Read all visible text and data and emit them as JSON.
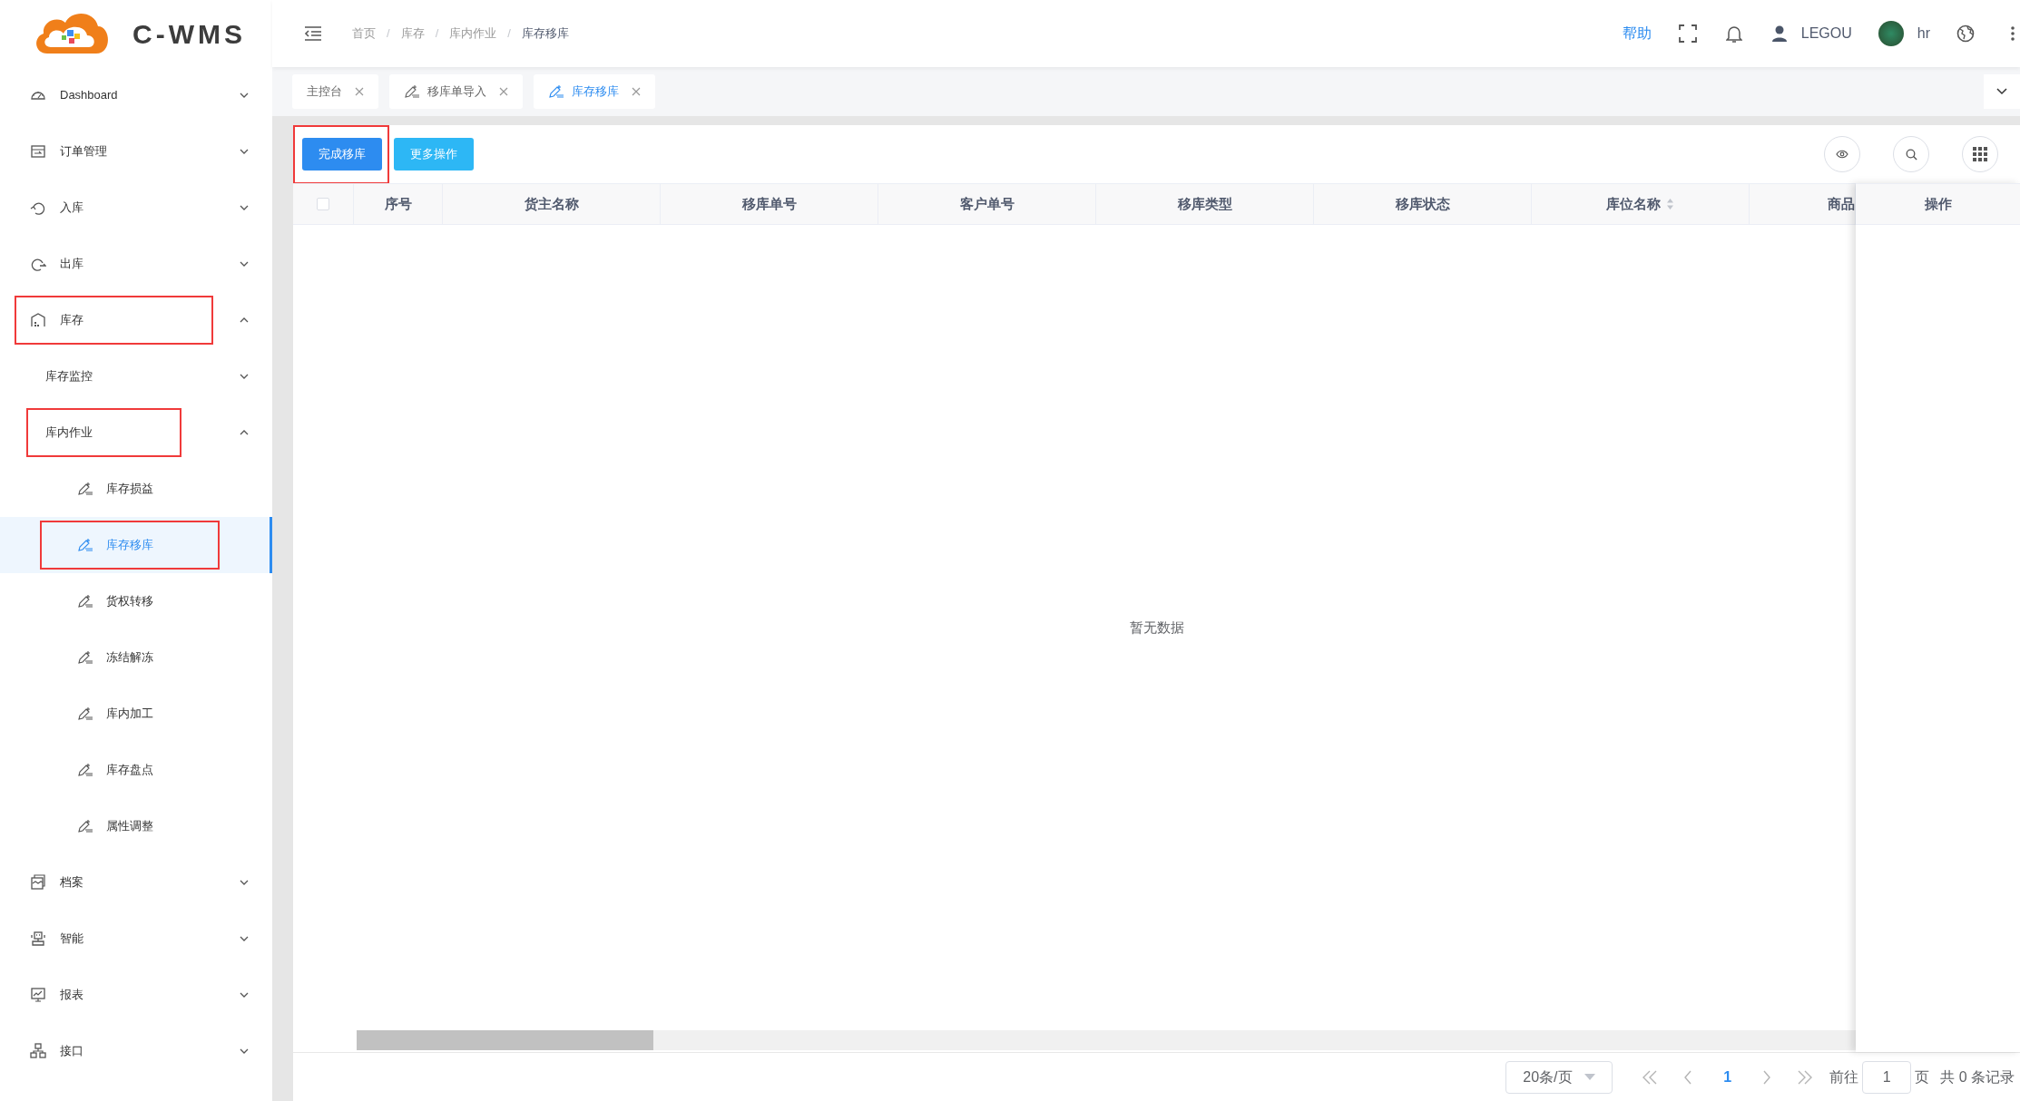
{
  "logo": {
    "text": "C-WMS"
  },
  "breadcrumb": {
    "items": [
      "首页",
      "库存",
      "库内作业",
      "库存移库"
    ],
    "separators": [
      "/",
      "/",
      "/"
    ]
  },
  "header": {
    "help": "帮助",
    "user": "LEGOU",
    "account": "hr"
  },
  "sidebar": {
    "items": [
      {
        "label": "Dashboard",
        "expanded": false,
        "annotated": false
      },
      {
        "label": "订单管理",
        "expanded": false,
        "annotated": false
      },
      {
        "label": "入库",
        "expanded": false,
        "annotated": false
      },
      {
        "label": "出库",
        "expanded": false,
        "annotated": false
      },
      {
        "label": "库存",
        "expanded": true,
        "annotated": true,
        "children": [
          {
            "label": "库存监控",
            "expanded": false,
            "annotated": false
          },
          {
            "label": "库内作业",
            "expanded": true,
            "annotated": true,
            "children": [
              {
                "label": "库存损益",
                "selected": false,
                "annotated": false
              },
              {
                "label": "库存移库",
                "selected": true,
                "annotated": true
              },
              {
                "label": "货权转移",
                "selected": false,
                "annotated": false
              },
              {
                "label": "冻结解冻",
                "selected": false,
                "annotated": false
              },
              {
                "label": "库内加工",
                "selected": false,
                "annotated": false
              },
              {
                "label": "库存盘点",
                "selected": false,
                "annotated": false
              },
              {
                "label": "属性调整",
                "selected": false,
                "annotated": false
              }
            ]
          }
        ]
      },
      {
        "label": "档案",
        "expanded": false,
        "annotated": false
      },
      {
        "label": "智能",
        "expanded": false,
        "annotated": false
      },
      {
        "label": "报表",
        "expanded": false,
        "annotated": false
      },
      {
        "label": "接口",
        "expanded": false,
        "annotated": false
      }
    ]
  },
  "tabs": [
    {
      "label": "主控台",
      "kind": "home",
      "selected": false
    },
    {
      "label": "移库单导入",
      "kind": "page",
      "selected": false
    },
    {
      "label": "库存移库",
      "kind": "page",
      "selected": true
    }
  ],
  "toolbar": {
    "buttons": [
      {
        "label": "完成移库",
        "kind": "primary",
        "annotated": true
      },
      {
        "label": "更多操作",
        "kind": "info",
        "annotated": false
      }
    ]
  },
  "table": {
    "columns": [
      {
        "label": "序号",
        "sortable": false
      },
      {
        "label": "货主名称",
        "sortable": false
      },
      {
        "label": "移库单号",
        "sortable": false
      },
      {
        "label": "客户单号",
        "sortable": false
      },
      {
        "label": "移库类型",
        "sortable": false
      },
      {
        "label": "移库状态",
        "sortable": false
      },
      {
        "label": "库位名称",
        "sortable": true
      },
      {
        "label": "商品",
        "sortable": false
      }
    ],
    "select_all_checked": false,
    "fixed_column": "操作",
    "empty_text": "暂无数据"
  },
  "pagination": {
    "page_size": "20条/页",
    "current_page": "1",
    "goto_label": "前往",
    "goto_value": "1",
    "page_unit": "页",
    "total": "共 0 条记录"
  }
}
